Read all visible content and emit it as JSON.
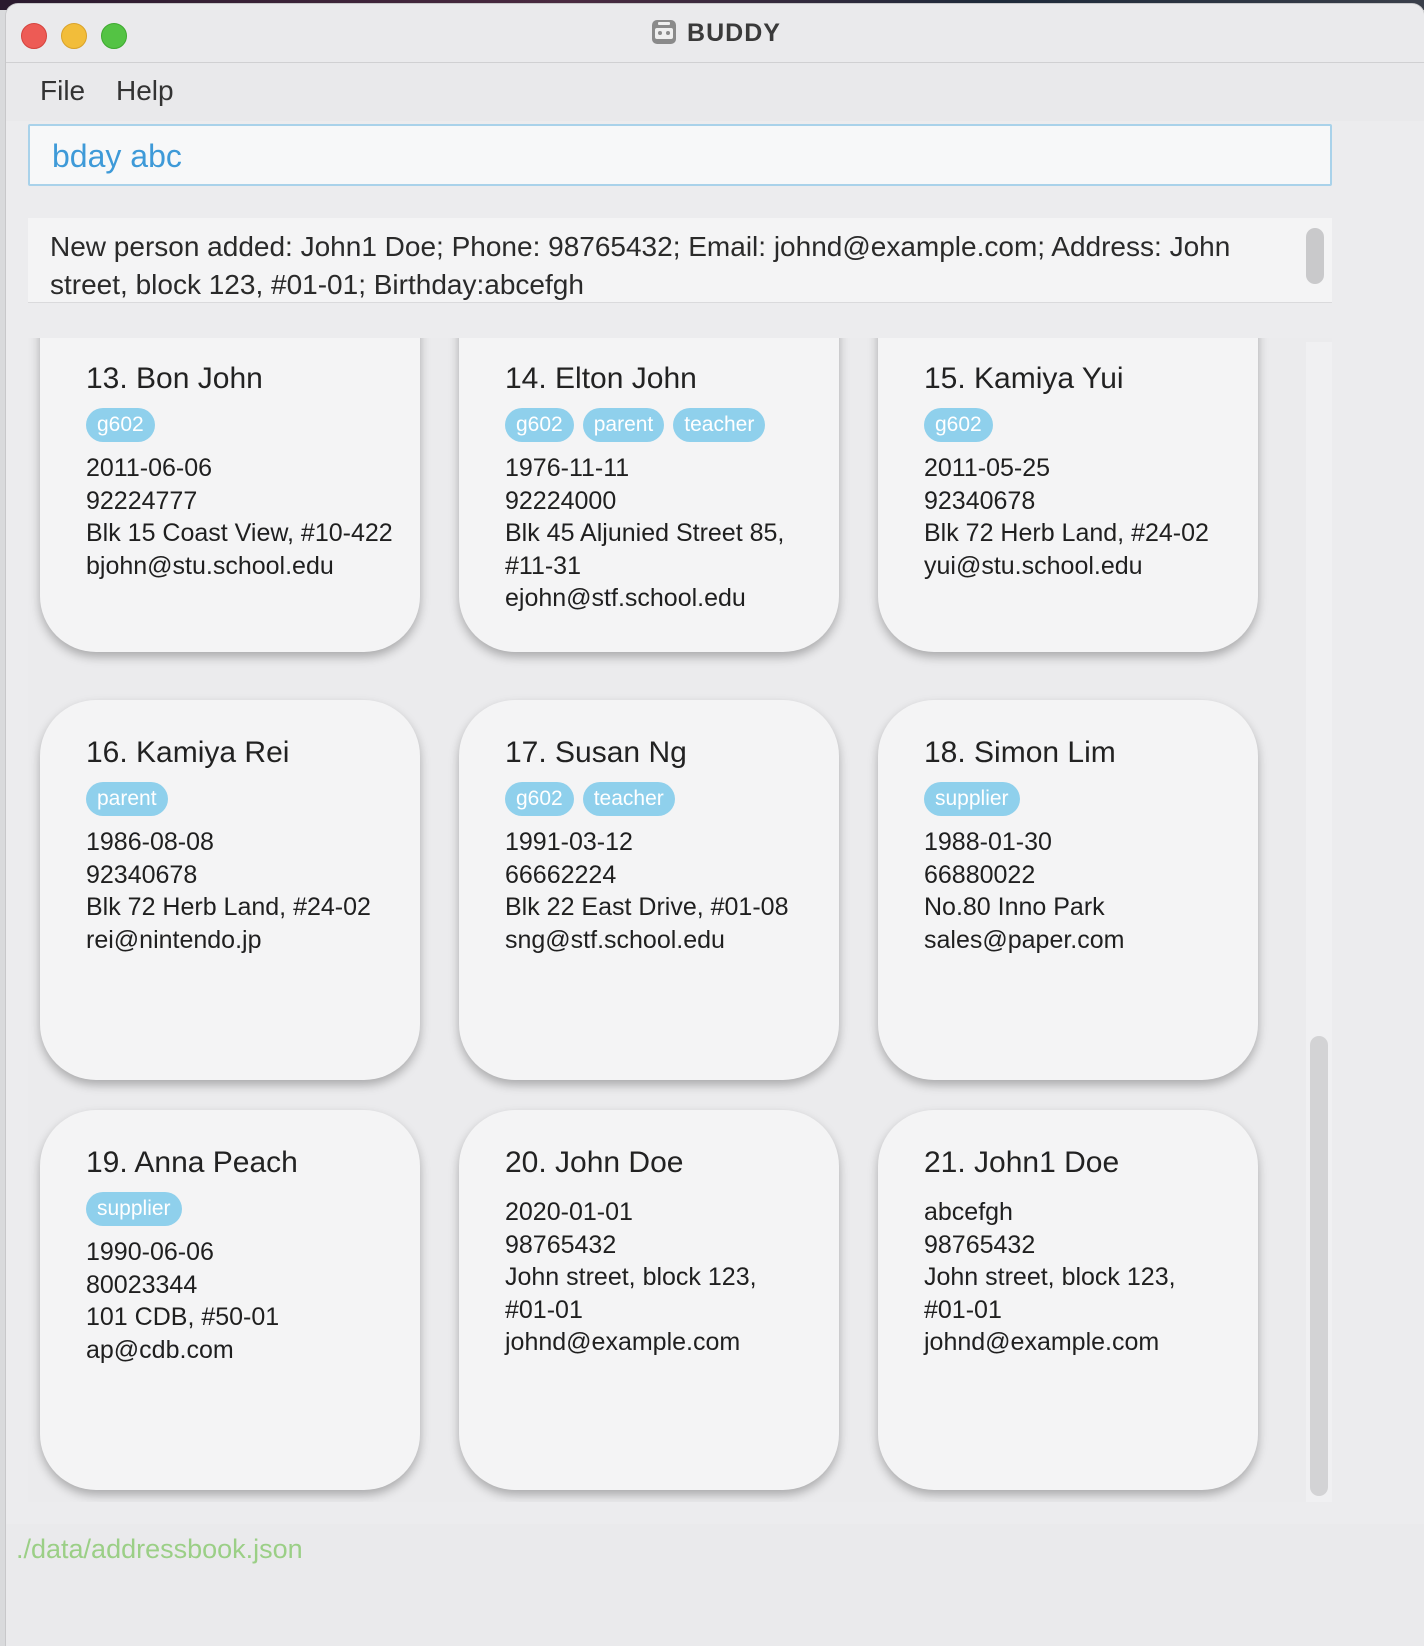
{
  "window": {
    "title": "BUDDY"
  },
  "menu": {
    "file": "File",
    "help": "Help"
  },
  "command": {
    "value": "bday abc"
  },
  "result": {
    "message": "New person added: John1 Doe; Phone: 98765432; Email: johnd@example.com; Address: John street, block 123, #01-01; Birthday:abcefgh"
  },
  "persons": [
    {
      "name": "13.  Bon John",
      "tags": [
        "g602"
      ],
      "lines": [
        "2011-06-06",
        "92224777",
        "Blk 15 Coast View, #10-422",
        "bjohn@stu.school.edu"
      ]
    },
    {
      "name": "14.  Elton John",
      "tags": [
        "g602",
        "parent",
        "teacher"
      ],
      "lines": [
        "1976-11-11",
        "92224000",
        "Blk 45 Aljunied Street 85,",
        "#11-31",
        "ejohn@stf.school.edu"
      ]
    },
    {
      "name": "15.  Kamiya Yui",
      "tags": [
        "g602"
      ],
      "lines": [
        "2011-05-25",
        "92340678",
        "Blk 72 Herb Land, #24-02",
        "yui@stu.school.edu"
      ]
    },
    {
      "name": "16.  Kamiya Rei",
      "tags": [
        "parent"
      ],
      "lines": [
        "1986-08-08",
        "92340678",
        "Blk 72 Herb Land, #24-02",
        "rei@nintendo.jp"
      ]
    },
    {
      "name": "17.  Susan Ng",
      "tags": [
        "g602",
        "teacher"
      ],
      "lines": [
        "1991-03-12",
        "66662224",
        "Blk 22 East Drive, #01-08",
        "sng@stf.school.edu"
      ]
    },
    {
      "name": "18.  Simon Lim",
      "tags": [
        "supplier"
      ],
      "lines": [
        "1988-01-30",
        "66880022",
        "No.80 Inno Park",
        "sales@paper.com"
      ]
    },
    {
      "name": "19.  Anna Peach",
      "tags": [
        "supplier"
      ],
      "lines": [
        "1990-06-06",
        "80023344",
        "101 CDB, #50-01",
        "ap@cdb.com"
      ]
    },
    {
      "name": "20.  John Doe",
      "tags": [],
      "lines": [
        "2020-01-01",
        "98765432",
        "John street, block 123,",
        "#01-01",
        "johnd@example.com"
      ]
    },
    {
      "name": "21.  John1 Doe",
      "tags": [],
      "lines": [
        "abcefgh",
        "98765432",
        "John street, block 123,",
        "#01-01",
        "johnd@example.com"
      ]
    }
  ],
  "status": {
    "path": "./data/addressbook.json"
  },
  "colors": {
    "tag": "#8fd0ec",
    "command_text": "#3e9ad8",
    "status_text": "#9bcf86"
  },
  "icons": {
    "app": "buddy-app-icon"
  }
}
